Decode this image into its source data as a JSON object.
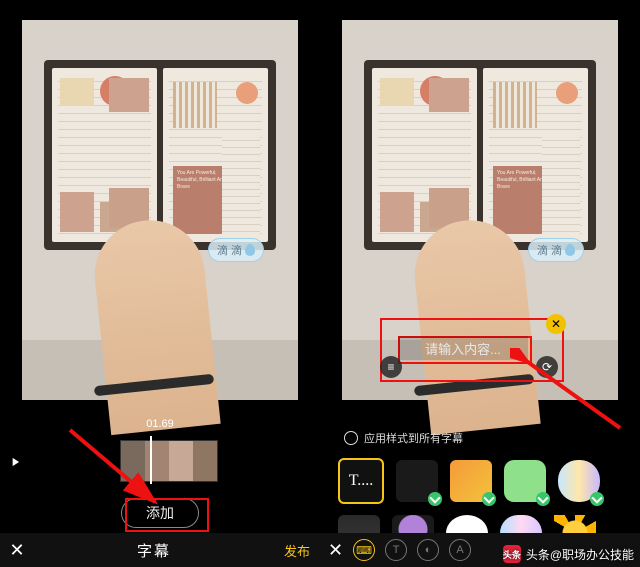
{
  "left": {
    "timecode": "01.69",
    "add_button": "添加",
    "bottom_title": "字幕",
    "publish": "发布",
    "sticker_text": "滴 滴",
    "card_text": "You Are Powerful, Beautiful, Brilliant And Brave"
  },
  "right": {
    "caption_placeholder": "请输入内容...",
    "apply_all": "应用样式到所有字幕",
    "style_T": "T....",
    "sticker_text": "滴 滴",
    "card_text": "You Are Powerful, Beautiful, Brilliant And Brave"
  },
  "watermark": {
    "logo": "头条",
    "text": "头条@职场办公技能"
  }
}
